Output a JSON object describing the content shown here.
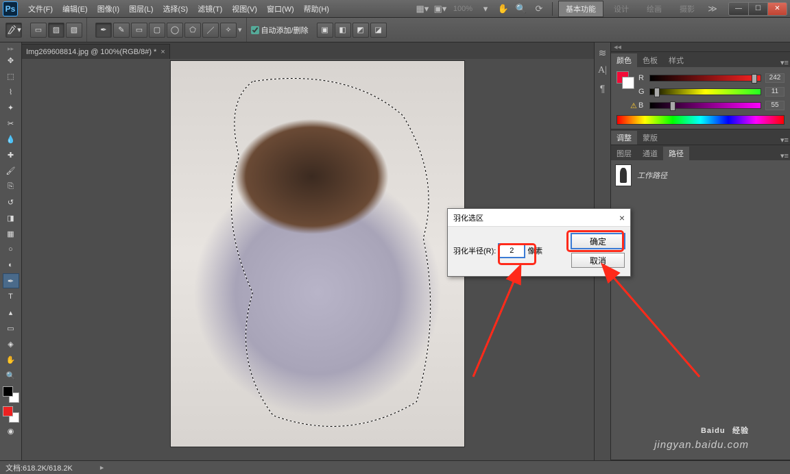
{
  "app": {
    "logo": "Ps"
  },
  "menu": [
    {
      "label": "文件(F)"
    },
    {
      "label": "编辑(E)"
    },
    {
      "label": "图像(I)"
    },
    {
      "label": "图层(L)"
    },
    {
      "label": "选择(S)"
    },
    {
      "label": "滤镜(T)"
    },
    {
      "label": "视图(V)"
    },
    {
      "label": "窗口(W)"
    },
    {
      "label": "帮助(H)"
    }
  ],
  "menuRight": {
    "zoom": "100%",
    "workspace_active": "基本功能",
    "workspaces": [
      "设计",
      "绘画",
      "摄影"
    ]
  },
  "options": {
    "auto_add_delete": "自动添加/删除"
  },
  "document": {
    "tab": "Img269608814.jpg @ 100%(RGB/8#) *"
  },
  "status": {
    "doc": "文档:618.2K/618.2K"
  },
  "panels": {
    "color": {
      "tabs": [
        "颜色",
        "色板",
        "样式"
      ],
      "channels": [
        {
          "l": "R",
          "v": "242",
          "cls": "r",
          "thumb": 92
        },
        {
          "l": "G",
          "v": "11",
          "cls": "g",
          "thumb": 4
        },
        {
          "l": "B",
          "v": "55",
          "cls": "b",
          "thumb": 18
        }
      ]
    },
    "adjust": {
      "tabs": [
        "调整",
        "蒙版"
      ]
    },
    "layers": {
      "tabs": [
        "图层",
        "通道",
        "路径"
      ],
      "active": 2,
      "path_name": "工作路径"
    }
  },
  "dialog": {
    "title": "羽化选区",
    "label": "羽化半径(R):",
    "value": "2",
    "unit": "像素",
    "ok": "确定",
    "cancel": "取消"
  },
  "watermark": {
    "brand": "Baidu",
    "suffix": "经验",
    "url": "jingyan.baidu.com"
  }
}
